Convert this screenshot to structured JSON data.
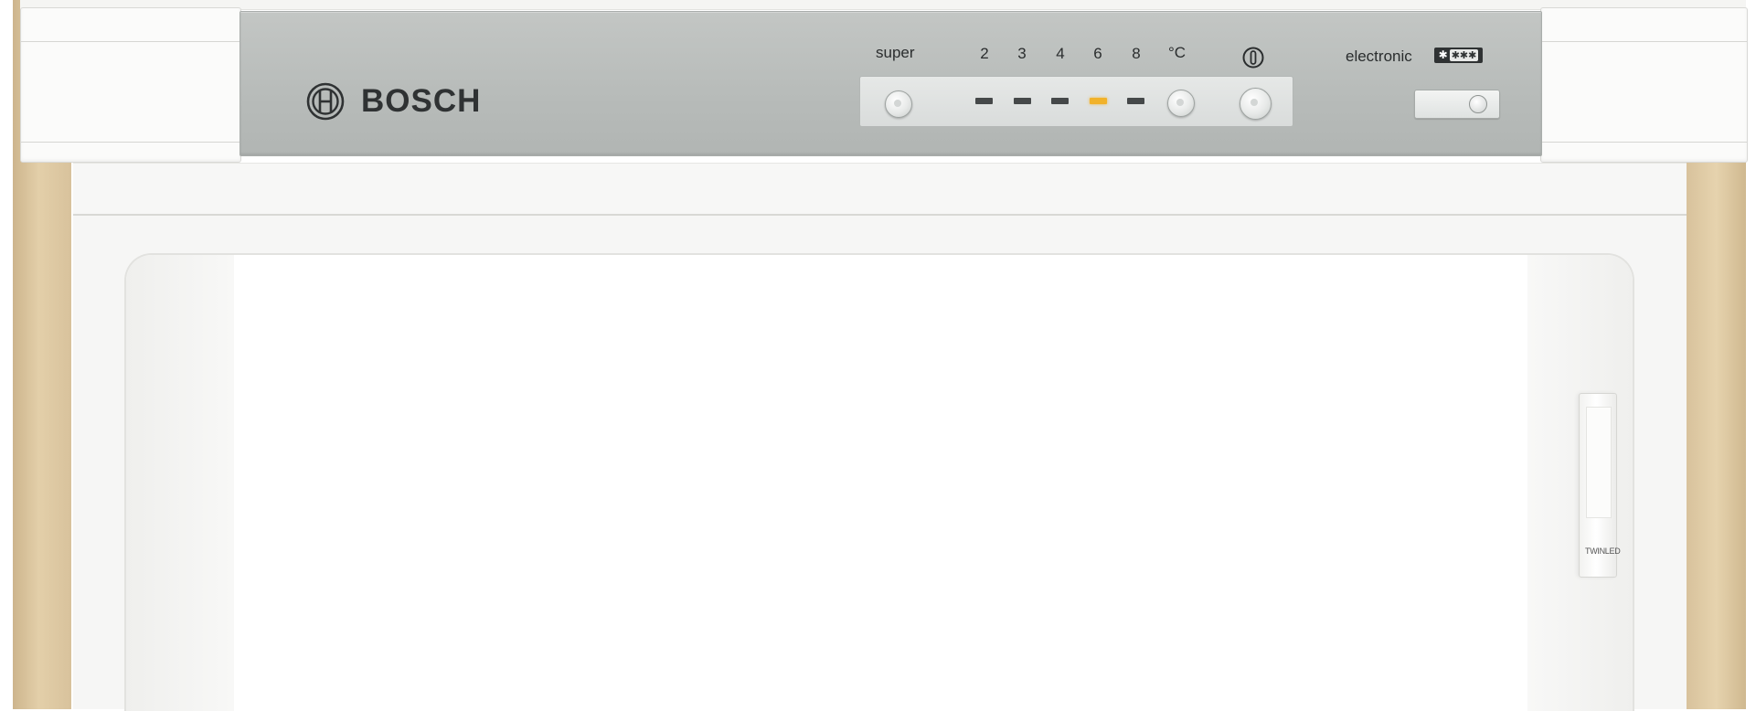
{
  "brand": {
    "name": "BOSCH",
    "icon": "bosch-armature-logo-icon"
  },
  "control_panel": {
    "super_label": "super",
    "temperatures": [
      "2",
      "3",
      "4",
      "6",
      "8"
    ],
    "unit_label": "°C",
    "active_temperature": "6",
    "power_icon": "power-icon",
    "electronic_label": "electronic",
    "freezer_rating": {
      "asterisk": "✱",
      "stars": "✱✱✱"
    }
  },
  "door": {
    "light_label": "TWINLED"
  },
  "colors": {
    "side_panel": "#d8c29c",
    "panel_grey": "#b7bbb9",
    "led_off": "#454849",
    "led_on": "#f1b22a",
    "text": "#2a2d2e"
  }
}
